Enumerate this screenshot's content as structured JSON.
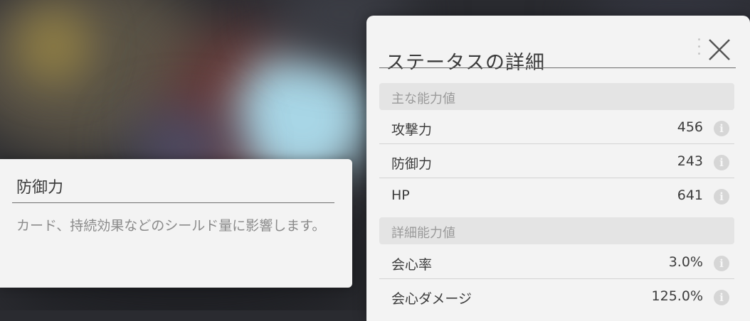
{
  "panel": {
    "title": "ステータスの詳細",
    "close_icon": "close-icon",
    "sections": [
      {
        "label": "主な能力値",
        "rows": [
          {
            "label": "攻撃力",
            "value": "456",
            "icon": "info-icon"
          },
          {
            "label": "防御力",
            "value": "243",
            "icon": "info-icon"
          },
          {
            "label": "HP",
            "value": "641",
            "icon": "info-icon"
          }
        ]
      },
      {
        "label": "詳細能力値",
        "rows": [
          {
            "label": "会心率",
            "value": "3.0%",
            "icon": "info-icon"
          },
          {
            "label": "会心ダメージ",
            "value": "125.0%",
            "icon": "info-icon"
          }
        ]
      }
    ]
  },
  "tooltip": {
    "title": "防御力",
    "body": "カード、持続効果などのシールド量に影響します。"
  },
  "colors": {
    "panel_bg": "#f3f3f3",
    "section_bg": "#e4e4e4",
    "text": "#3c3c3c",
    "muted_text": "#8a8a8a"
  }
}
